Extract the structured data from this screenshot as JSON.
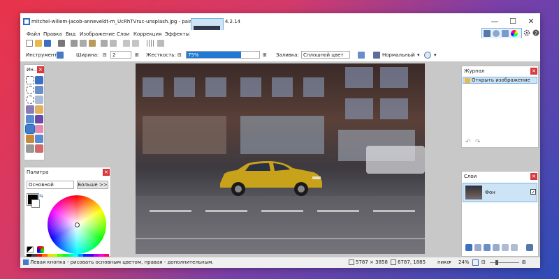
{
  "window": {
    "title": "mitchel-willem-jacob-anneveldt-m_UcRhTVruc-unsplash.jpg - paint.net версия 4.2.14",
    "min_glyph": "—",
    "max_glyph": "☐",
    "close_glyph": "✕"
  },
  "menu": [
    "Файл",
    "Правка",
    "Вид",
    "Изображение",
    "Слои",
    "Коррекция",
    "Эффекты"
  ],
  "toolbar2": {
    "tool_label": "Инструмент:",
    "width_label": "Ширина:",
    "width_value": "2",
    "hardness_label": "Жесткость:",
    "hardness_value": "75%",
    "fill_label": "Заливка:",
    "fill_value": "Сплошной цвет",
    "blend_value": "Нормальный"
  },
  "tools_panel": {
    "title": "Ин..."
  },
  "palette": {
    "title": "Палитра",
    "mode": "Основной",
    "more_button": "Больше >>",
    "swatches": [
      "#000000",
      "#404040",
      "#ff0000",
      "#ff6a00",
      "#ffd800",
      "#b6ff00",
      "#4cff00",
      "#00ff21",
      "#00ff90",
      "#00ffff",
      "#0094ff",
      "#0026ff",
      "#4800ff",
      "#b200ff",
      "#ff00dc",
      "#ff006e"
    ]
  },
  "history": {
    "title": "Журнал",
    "items": [
      "Открыть изображение"
    ]
  },
  "layers": {
    "title": "Слои",
    "items": [
      {
        "name": "Фон",
        "visible": true
      }
    ]
  },
  "status": {
    "hint": "Левая кнопка - рисовать основным цветом, правая - дополнительным.",
    "image_size": "5787 × 3858",
    "cursor_pos": "6787, 1885",
    "units": "пикс",
    "zoom": "24%"
  },
  "colors": {
    "accent": "#0078d7",
    "close_red": "#d9363e",
    "selection": "#cde4f7"
  }
}
